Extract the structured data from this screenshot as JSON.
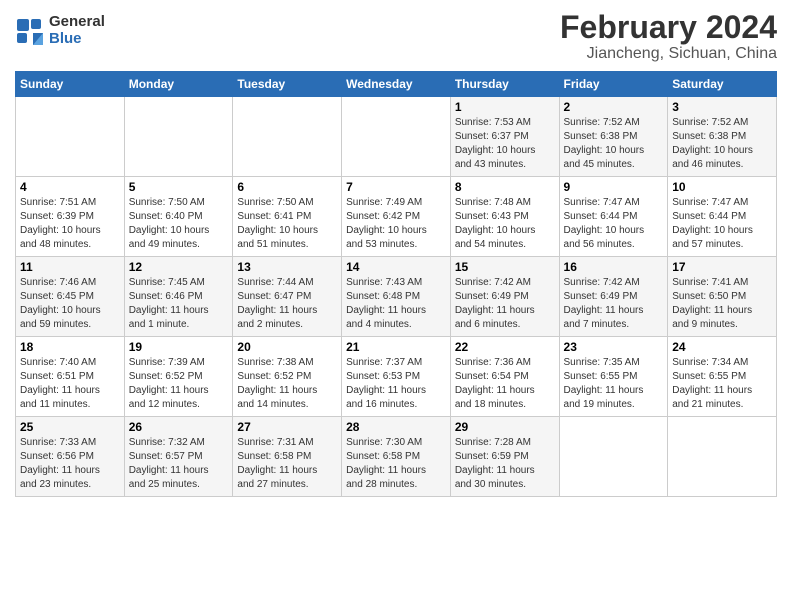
{
  "logo": {
    "general": "General",
    "blue": "Blue"
  },
  "header": {
    "month": "February 2024",
    "location": "Jiancheng, Sichuan, China"
  },
  "weekdays": [
    "Sunday",
    "Monday",
    "Tuesday",
    "Wednesday",
    "Thursday",
    "Friday",
    "Saturday"
  ],
  "weeks": [
    [
      {
        "day": "",
        "info": ""
      },
      {
        "day": "",
        "info": ""
      },
      {
        "day": "",
        "info": ""
      },
      {
        "day": "",
        "info": ""
      },
      {
        "day": "1",
        "info": "Sunrise: 7:53 AM\nSunset: 6:37 PM\nDaylight: 10 hours\nand 43 minutes."
      },
      {
        "day": "2",
        "info": "Sunrise: 7:52 AM\nSunset: 6:38 PM\nDaylight: 10 hours\nand 45 minutes."
      },
      {
        "day": "3",
        "info": "Sunrise: 7:52 AM\nSunset: 6:38 PM\nDaylight: 10 hours\nand 46 minutes."
      }
    ],
    [
      {
        "day": "4",
        "info": "Sunrise: 7:51 AM\nSunset: 6:39 PM\nDaylight: 10 hours\nand 48 minutes."
      },
      {
        "day": "5",
        "info": "Sunrise: 7:50 AM\nSunset: 6:40 PM\nDaylight: 10 hours\nand 49 minutes."
      },
      {
        "day": "6",
        "info": "Sunrise: 7:50 AM\nSunset: 6:41 PM\nDaylight: 10 hours\nand 51 minutes."
      },
      {
        "day": "7",
        "info": "Sunrise: 7:49 AM\nSunset: 6:42 PM\nDaylight: 10 hours\nand 53 minutes."
      },
      {
        "day": "8",
        "info": "Sunrise: 7:48 AM\nSunset: 6:43 PM\nDaylight: 10 hours\nand 54 minutes."
      },
      {
        "day": "9",
        "info": "Sunrise: 7:47 AM\nSunset: 6:44 PM\nDaylight: 10 hours\nand 56 minutes."
      },
      {
        "day": "10",
        "info": "Sunrise: 7:47 AM\nSunset: 6:44 PM\nDaylight: 10 hours\nand 57 minutes."
      }
    ],
    [
      {
        "day": "11",
        "info": "Sunrise: 7:46 AM\nSunset: 6:45 PM\nDaylight: 10 hours\nand 59 minutes."
      },
      {
        "day": "12",
        "info": "Sunrise: 7:45 AM\nSunset: 6:46 PM\nDaylight: 11 hours\nand 1 minute."
      },
      {
        "day": "13",
        "info": "Sunrise: 7:44 AM\nSunset: 6:47 PM\nDaylight: 11 hours\nand 2 minutes."
      },
      {
        "day": "14",
        "info": "Sunrise: 7:43 AM\nSunset: 6:48 PM\nDaylight: 11 hours\nand 4 minutes."
      },
      {
        "day": "15",
        "info": "Sunrise: 7:42 AM\nSunset: 6:49 PM\nDaylight: 11 hours\nand 6 minutes."
      },
      {
        "day": "16",
        "info": "Sunrise: 7:42 AM\nSunset: 6:49 PM\nDaylight: 11 hours\nand 7 minutes."
      },
      {
        "day": "17",
        "info": "Sunrise: 7:41 AM\nSunset: 6:50 PM\nDaylight: 11 hours\nand 9 minutes."
      }
    ],
    [
      {
        "day": "18",
        "info": "Sunrise: 7:40 AM\nSunset: 6:51 PM\nDaylight: 11 hours\nand 11 minutes."
      },
      {
        "day": "19",
        "info": "Sunrise: 7:39 AM\nSunset: 6:52 PM\nDaylight: 11 hours\nand 12 minutes."
      },
      {
        "day": "20",
        "info": "Sunrise: 7:38 AM\nSunset: 6:52 PM\nDaylight: 11 hours\nand 14 minutes."
      },
      {
        "day": "21",
        "info": "Sunrise: 7:37 AM\nSunset: 6:53 PM\nDaylight: 11 hours\nand 16 minutes."
      },
      {
        "day": "22",
        "info": "Sunrise: 7:36 AM\nSunset: 6:54 PM\nDaylight: 11 hours\nand 18 minutes."
      },
      {
        "day": "23",
        "info": "Sunrise: 7:35 AM\nSunset: 6:55 PM\nDaylight: 11 hours\nand 19 minutes."
      },
      {
        "day": "24",
        "info": "Sunrise: 7:34 AM\nSunset: 6:55 PM\nDaylight: 11 hours\nand 21 minutes."
      }
    ],
    [
      {
        "day": "25",
        "info": "Sunrise: 7:33 AM\nSunset: 6:56 PM\nDaylight: 11 hours\nand 23 minutes."
      },
      {
        "day": "26",
        "info": "Sunrise: 7:32 AM\nSunset: 6:57 PM\nDaylight: 11 hours\nand 25 minutes."
      },
      {
        "day": "27",
        "info": "Sunrise: 7:31 AM\nSunset: 6:58 PM\nDaylight: 11 hours\nand 27 minutes."
      },
      {
        "day": "28",
        "info": "Sunrise: 7:30 AM\nSunset: 6:58 PM\nDaylight: 11 hours\nand 28 minutes."
      },
      {
        "day": "29",
        "info": "Sunrise: 7:28 AM\nSunset: 6:59 PM\nDaylight: 11 hours\nand 30 minutes."
      },
      {
        "day": "",
        "info": ""
      },
      {
        "day": "",
        "info": ""
      }
    ]
  ]
}
